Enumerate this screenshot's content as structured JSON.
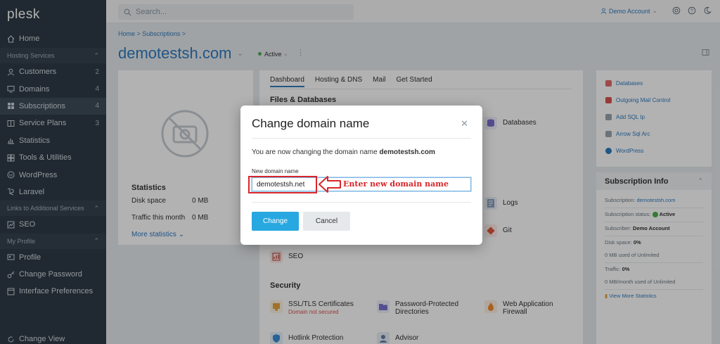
{
  "app": {
    "logo": "plesk"
  },
  "sidebar": {
    "home": "Home",
    "hosting_services": "Hosting Services",
    "items": [
      {
        "label": "Customers",
        "count": "2",
        "icon": "user-icon"
      },
      {
        "label": "Domains",
        "count": "4",
        "icon": "monitor-icon"
      },
      {
        "label": "Subscriptions",
        "count": "4",
        "icon": "grid-icon"
      },
      {
        "label": "Service Plans",
        "count": "3",
        "icon": "book-icon"
      },
      {
        "label": "Statistics",
        "count": "",
        "icon": "bar-chart-icon"
      },
      {
        "label": "Tools & Utilities",
        "count": "",
        "icon": "tools-icon"
      },
      {
        "label": "WordPress",
        "count": "",
        "icon": "wordpress-icon"
      },
      {
        "label": "Laravel",
        "count": "",
        "icon": "laravel-icon"
      }
    ],
    "links_section": "Links to Additional Services",
    "seo": "SEO",
    "my_profile": "My Profile",
    "profile": "Profile",
    "change_password": "Change Password",
    "interface_prefs": "Interface Preferences",
    "change_view": "Change View"
  },
  "topbar": {
    "search_placeholder": "Search...",
    "account": "Demo Account"
  },
  "page": {
    "breadcrumb": "Home  >  Subscriptions  >",
    "title": "demotestsh.com",
    "status": "Active"
  },
  "left_card": {
    "stats_title": "Statistics",
    "disk_label": "Disk space",
    "disk_value": "0 MB",
    "traffic_label": "Traffic this month",
    "traffic_value": "0 MB",
    "more": "More statistics"
  },
  "main_card": {
    "tabs": [
      "Dashboard",
      "Hosting & DNS",
      "Mail",
      "Get Started"
    ],
    "files_db_title": "Files & Databases",
    "databases": "Databases",
    "logs": "Logs",
    "git": "Git",
    "seo": "SEO",
    "security_title": "Security",
    "ssl": "SSL/TLS Certificates",
    "ssl_sub": "Domain not secured",
    "pwd_dirs": "Password-Protected Directories",
    "waf": "Web Application Firewall",
    "hotlink": "Hotlink Protection",
    "advisor": "Advisor"
  },
  "right_links": [
    "Databases",
    "Outgoing Mail Control",
    "Add SQL Ip",
    "Arrow Sql Arc",
    "WordPress"
  ],
  "subscription_info": {
    "title": "Subscription Info",
    "domain_label": "Subscription:",
    "domain_value": "demotestsh.com",
    "status_label": "Subscription status:",
    "status_value": "Active",
    "subscriber_label": "Subscriber:",
    "subscriber_value": "Demo Account",
    "disk_label": "Disk space:",
    "disk_pct": "0%",
    "disk_used": "0 MB used of Unlimited",
    "traffic_label": "Traffic:",
    "traffic_pct": "0%",
    "traffic_used": "0 MB/month used of Unlimited",
    "view_more": "View More Statistics"
  },
  "modal": {
    "title": "Change domain name",
    "message_prefix": "You are now changing the domain name",
    "message_domain": "demotestsh.com",
    "field_label": "New domain name",
    "field_value": "demotestsh.net",
    "change_button": "Change",
    "cancel_button": "Cancel"
  },
  "annotation": {
    "text": "Enter new domain name",
    "color": "#d9262b"
  },
  "colors": {
    "accent": "#2f7bbf",
    "primary_button": "#28a8e0",
    "sidebar_bg": "#2e3b47"
  }
}
